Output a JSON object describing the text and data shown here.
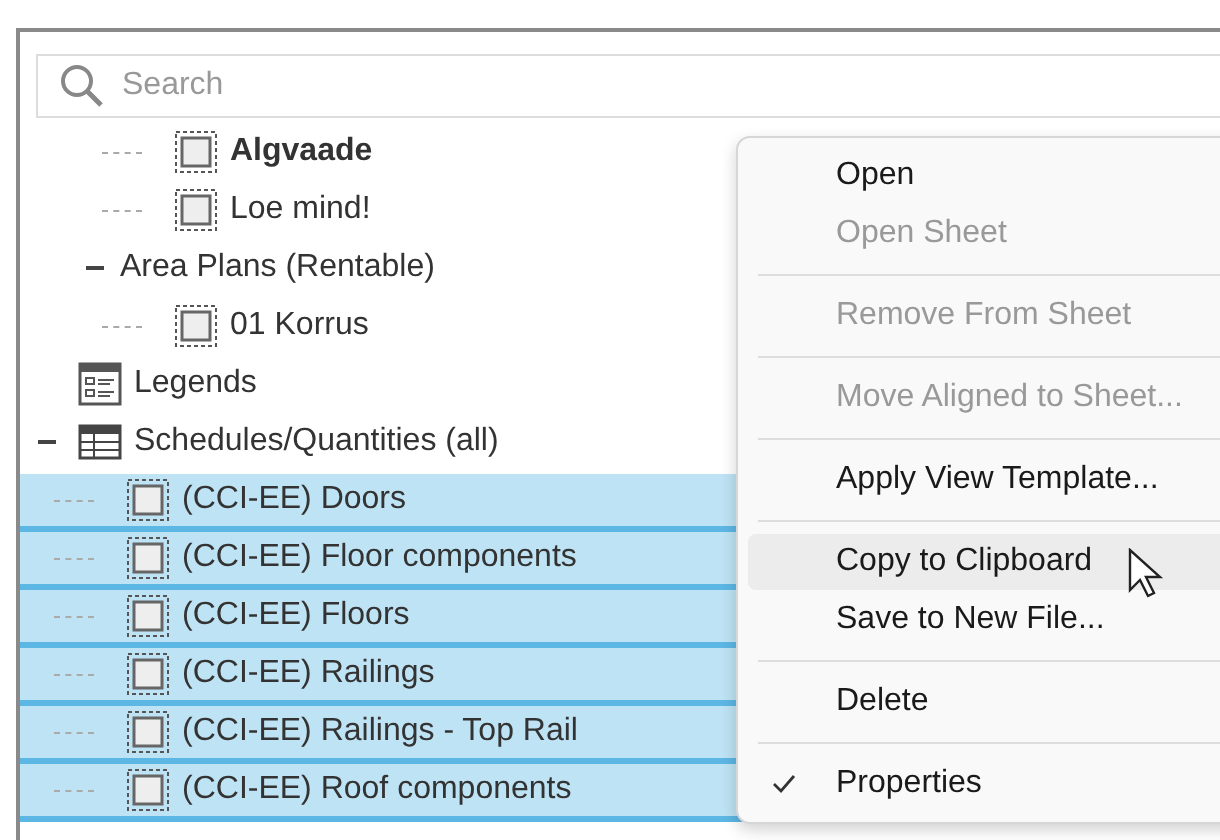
{
  "search": {
    "placeholder": "Search"
  },
  "tree": [
    {
      "children": [
        {
          "children": [
            {
              "label": "Algvaade",
              "kind": "view",
              "bold": true,
              "selected": false
            },
            {
              "label": "Loe mind!",
              "kind": "view",
              "bold": false,
              "selected": false
            }
          ]
        },
        {
          "label": "Area Plans (Rentable)",
          "expanded": true,
          "bold": false,
          "selected": false,
          "children": [
            {
              "label": "01 Korrus",
              "kind": "view",
              "bold": false,
              "selected": false
            }
          ]
        }
      ]
    },
    {
      "label": "Legends",
      "kind": "legend",
      "bold": false,
      "selected": false
    },
    {
      "label": "Schedules/Quantities (all)",
      "kind": "schedule",
      "expanded": true,
      "bold": false,
      "selected": false,
      "children": [
        {
          "label": "(CCI-EE) Doors",
          "kind": "view",
          "bold": false,
          "selected": true
        },
        {
          "label": "(CCI-EE) Floor components",
          "kind": "view",
          "bold": false,
          "selected": true
        },
        {
          "label": "(CCI-EE) Floors",
          "kind": "view",
          "bold": false,
          "selected": true
        },
        {
          "label": "(CCI-EE) Railings",
          "kind": "view",
          "bold": false,
          "selected": true
        },
        {
          "label": "(CCI-EE) Railings - Top Rail",
          "kind": "view",
          "bold": false,
          "selected": true
        },
        {
          "label": "(CCI-EE) Roof components",
          "kind": "view",
          "bold": false,
          "selected": true
        }
      ]
    }
  ],
  "context_menu": [
    {
      "kind": "item",
      "label": "Open",
      "disabled": false,
      "highlighted": false,
      "checked": false
    },
    {
      "kind": "item",
      "label": "Open Sheet",
      "disabled": true,
      "highlighted": false,
      "checked": false
    },
    {
      "kind": "separator"
    },
    {
      "kind": "item",
      "label": "Remove From Sheet",
      "disabled": true,
      "highlighted": false,
      "checked": false
    },
    {
      "kind": "separator"
    },
    {
      "kind": "item",
      "label": "Move Aligned to Sheet...",
      "disabled": true,
      "highlighted": false,
      "checked": false
    },
    {
      "kind": "separator"
    },
    {
      "kind": "item",
      "label": "Apply View Template...",
      "disabled": false,
      "highlighted": false,
      "checked": false
    },
    {
      "kind": "separator"
    },
    {
      "kind": "item",
      "label": "Copy to Clipboard",
      "disabled": false,
      "highlighted": true,
      "checked": false
    },
    {
      "kind": "item",
      "label": "Save to New File...",
      "disabled": false,
      "highlighted": false,
      "checked": false
    },
    {
      "kind": "separator"
    },
    {
      "kind": "item",
      "label": "Delete",
      "disabled": false,
      "highlighted": false,
      "checked": false
    },
    {
      "kind": "separator"
    },
    {
      "kind": "item",
      "label": "Properties",
      "disabled": false,
      "highlighted": false,
      "checked": true
    }
  ]
}
